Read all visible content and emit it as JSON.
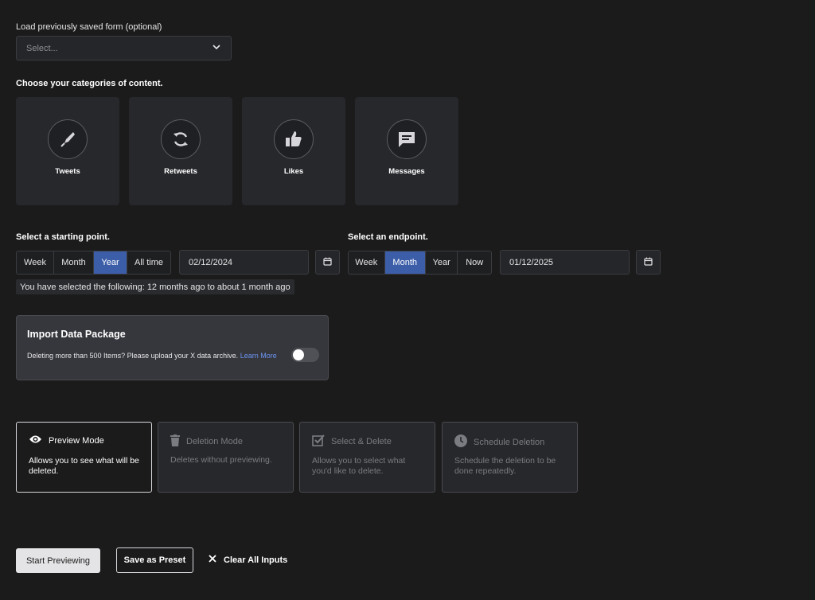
{
  "saved_form": {
    "label": "Load previously saved form (optional)",
    "placeholder": "Select..."
  },
  "categories": {
    "heading": "Choose your categories of content.",
    "items": [
      {
        "label": "Tweets",
        "icon": "feather-icon"
      },
      {
        "label": "Retweets",
        "icon": "retweet-icon"
      },
      {
        "label": "Likes",
        "icon": "thumbs-up-icon"
      },
      {
        "label": "Messages",
        "icon": "message-icon"
      }
    ]
  },
  "start": {
    "heading": "Select a starting point.",
    "options": [
      "Week",
      "Month",
      "Year",
      "All time"
    ],
    "selected": "Year",
    "date": "02/12/2024"
  },
  "end": {
    "heading": "Select an endpoint.",
    "options": [
      "Week",
      "Month",
      "Year",
      "Now"
    ],
    "selected": "Month",
    "date": "01/12/2025"
  },
  "summary": "You have selected the following: 12 months ago to about 1 month ago",
  "import_package": {
    "title": "Import Data Package",
    "text": "Deleting more than 500 Items? Please upload your X data archive.",
    "link": "Learn More",
    "toggle_on": false
  },
  "modes": [
    {
      "title": "Preview Mode",
      "desc": "Allows you to see what will be deleted.",
      "icon": "eye-icon",
      "selected": true
    },
    {
      "title": "Deletion Mode",
      "desc": "Deletes without previewing.",
      "icon": "trash-icon",
      "selected": false
    },
    {
      "title": "Select & Delete",
      "desc": "Allows you to select what you'd like to delete.",
      "icon": "checkbox-icon",
      "selected": false
    },
    {
      "title": "Schedule Deletion",
      "desc": "Schedule the deletion to be done repeatedly.",
      "icon": "clock-icon",
      "selected": false
    }
  ],
  "actions": {
    "start": "Start Previewing",
    "preset": "Save as Preset",
    "clear": "Clear All Inputs"
  },
  "colors": {
    "background": "#1b1b1c",
    "accent": "#3c5ea9",
    "link": "#6b94f0"
  }
}
